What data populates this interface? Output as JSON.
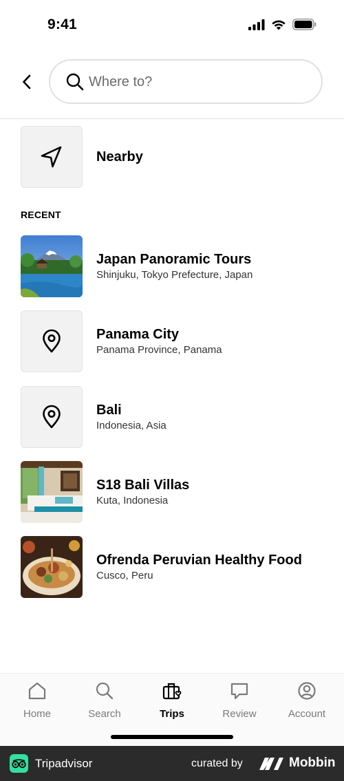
{
  "status_bar": {
    "time": "9:41"
  },
  "search": {
    "placeholder": "Where to?"
  },
  "nearby": {
    "label": "Nearby"
  },
  "recent": {
    "heading": "RECENT",
    "items": [
      {
        "title": "Japan Panoramic Tours",
        "subtitle": "Shinjuku, Tokyo Prefecture, Japan",
        "thumb": "photo-mountain-lake"
      },
      {
        "title": "Panama City",
        "subtitle": "Panama Province, Panama",
        "thumb": "location-pin-icon"
      },
      {
        "title": "Bali",
        "subtitle": "Indonesia, Asia",
        "thumb": "location-pin-icon"
      },
      {
        "title": "S18 Bali Villas",
        "subtitle": "Kuta, Indonesia",
        "thumb": "photo-hotel-room"
      },
      {
        "title": "Ofrenda Peruvian Healthy Food",
        "subtitle": "Cusco, Peru",
        "thumb": "photo-food-platter"
      }
    ]
  },
  "tabbar": {
    "tabs": [
      {
        "label": "Home",
        "icon": "home-icon"
      },
      {
        "label": "Search",
        "icon": "search-icon"
      },
      {
        "label": "Trips",
        "icon": "trips-icon",
        "active": true
      },
      {
        "label": "Review",
        "icon": "review-icon"
      },
      {
        "label": "Account",
        "icon": "account-icon"
      }
    ]
  },
  "footer": {
    "brand": "Tripadvisor",
    "curated_by": "curated by",
    "curator": "Mobbin"
  },
  "colors": {
    "tripadvisor_green": "#34e0a1",
    "footer_bg": "#2b2b2b",
    "tile_bg": "#f2f2f2"
  }
}
